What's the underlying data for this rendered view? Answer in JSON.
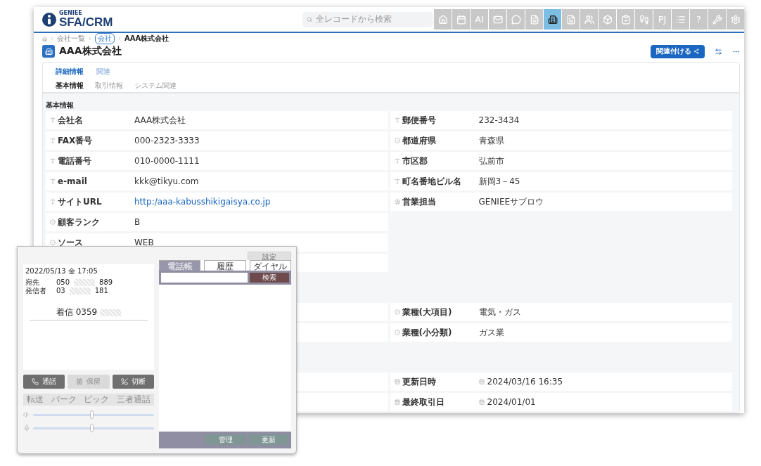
{
  "app": {
    "brand_small": "GENIEE",
    "brand": "SFA/CRM",
    "search": {
      "placeholder": "全レコードから検索"
    },
    "toolbar": [
      {
        "kind": "home",
        "selected": false
      },
      {
        "kind": "calendar",
        "selected": false
      },
      {
        "kind": "text",
        "label": "AI",
        "selected": false
      },
      {
        "kind": "mail",
        "selected": false
      },
      {
        "kind": "chat",
        "selected": false
      },
      {
        "kind": "person-doc",
        "selected": false
      },
      {
        "kind": "building",
        "selected": true
      },
      {
        "kind": "person-doc",
        "selected": false
      },
      {
        "kind": "people",
        "selected": false
      },
      {
        "kind": "box",
        "selected": false
      },
      {
        "kind": "clipboard",
        "selected": false
      },
      {
        "kind": "footprints",
        "selected": false
      },
      {
        "kind": "text",
        "label": "PJ",
        "selected": false
      },
      {
        "kind": "list",
        "selected": false
      },
      {
        "kind": "text",
        "label": "?",
        "selected": false
      },
      {
        "kind": "wrench",
        "selected": false
      },
      {
        "kind": "gear",
        "selected": false
      }
    ]
  },
  "breadcrumb": [
    {
      "kind": "home"
    },
    {
      "kind": "link",
      "label": "会社一覧"
    },
    {
      "kind": "tag",
      "label": "会社"
    },
    {
      "kind": "current",
      "label": "AAA株式会社"
    }
  ],
  "record": {
    "title": "AAA株式会社",
    "action": "関連付ける"
  },
  "tabs": [
    {
      "label": "詳細情報",
      "selected": true
    },
    {
      "label": "関連",
      "selected": false
    }
  ],
  "subtabs": [
    {
      "label": "基本情報",
      "selected": true
    },
    {
      "label": "取引情報",
      "selected": false
    },
    {
      "label": "システム関連",
      "selected": false
    }
  ],
  "sections": [
    {
      "title": "基本情報",
      "left": [
        {
          "kind": "text",
          "label": "会社名",
          "value": "AAA株式会社",
          "link": false
        },
        {
          "kind": "text",
          "label": "FAX番号",
          "value": "000-2323-3333",
          "link": false
        },
        {
          "kind": "text",
          "label": "電話番号",
          "value": "010-0000-1111",
          "link": false
        },
        {
          "kind": "text",
          "label": "e-mail",
          "value": "kkk@tikyu.com",
          "link": false
        },
        {
          "kind": "text",
          "label": "サイトURL",
          "value": "http:/aaa-kabusshikigaisya.co.jp",
          "link": true
        },
        {
          "kind": "select",
          "label": "顧客ランク",
          "value": "B",
          "link": false
        },
        {
          "kind": "select",
          "label": "ソース",
          "value": "WEB",
          "link": false
        }
      ],
      "right": [
        {
          "kind": "text",
          "label": "郵便番号",
          "value": "232-3434",
          "link": false
        },
        {
          "kind": "select",
          "label": "都道府県",
          "value": "青森県",
          "link": false
        },
        {
          "kind": "text",
          "label": "市区郡",
          "value": "弘前市",
          "link": false
        },
        {
          "kind": "text",
          "label": "町名番地ビル名",
          "value": "新岡3－45",
          "link": false
        },
        {
          "kind": "user",
          "label": "営業担当",
          "value": "GENIEEサブロウ",
          "link": false
        }
      ]
    },
    {
      "right": [
        {
          "kind": "select",
          "label": "業種(大項目)",
          "value": "電気・ガス",
          "link": false
        },
        {
          "kind": "select",
          "label": "業種(小分類)",
          "value": "ガス業",
          "link": false
        }
      ]
    },
    {
      "right": [
        {
          "kind": "date",
          "label": "更新日時",
          "value": "2024/03/16 16:35",
          "link": false
        },
        {
          "kind": "date",
          "label": "最終取引日",
          "value": "2024/01/01",
          "link": false
        }
      ]
    }
  ],
  "phone": {
    "settings": "設定",
    "datetime": "2022/05/13 金 17:05",
    "lines": [
      {
        "label": "宛先",
        "start": "050",
        "end": "889"
      },
      {
        "label": "発信者",
        "start": "03",
        "end": "181"
      }
    ],
    "incoming": {
      "label": "着信",
      "number": "0359"
    },
    "tabs": [
      {
        "label": "電話帳",
        "selected": true
      },
      {
        "label": "履歴",
        "selected": false
      },
      {
        "label": "ダイヤル",
        "selected": false
      }
    ],
    "search_button": "検索",
    "call_buttons": [
      {
        "kind": "call",
        "label": "通話",
        "disabled": false
      },
      {
        "kind": "hold",
        "label": "保留",
        "disabled": true
      },
      {
        "kind": "hangup",
        "label": "切断",
        "disabled": false
      }
    ],
    "transfer_buttons": [
      {
        "label": "転送",
        "disabled": true
      },
      {
        "label": "パーク",
        "disabled": true
      },
      {
        "label": "ピック",
        "disabled": true
      },
      {
        "label": "三者通話",
        "disabled": true
      }
    ],
    "sliders": [
      {
        "kind": "speaker",
        "level": 0.48
      },
      {
        "kind": "mic",
        "level": 0.48
      }
    ],
    "footer_buttons": [
      "管理",
      "更新"
    ]
  }
}
